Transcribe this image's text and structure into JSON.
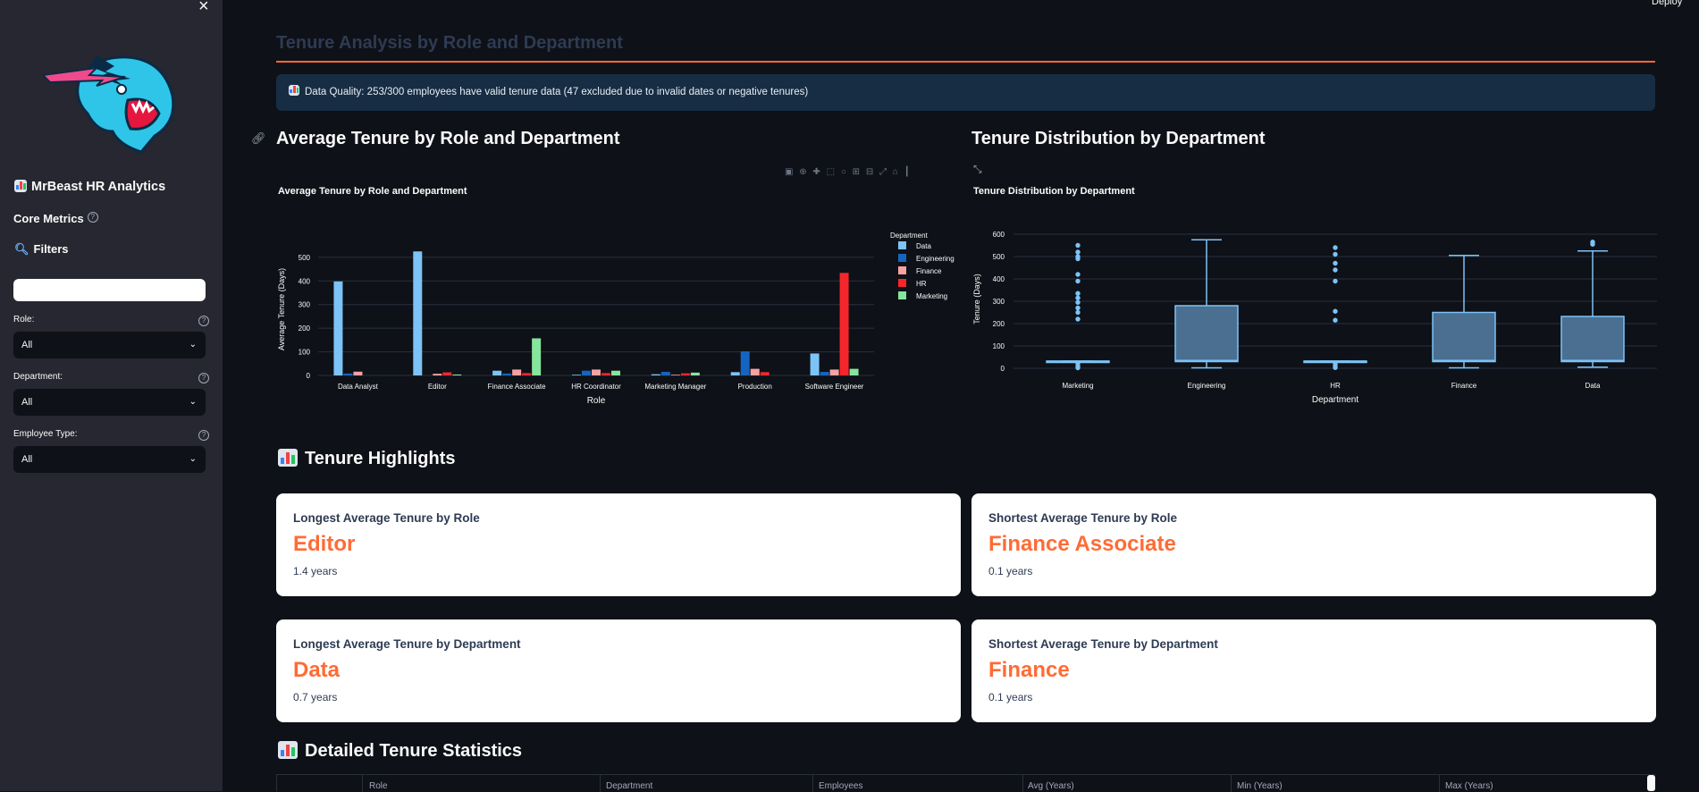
{
  "sidebar": {
    "close_icon": "×",
    "app_title": "MrBeast HR Analytics",
    "core_metrics": "Core Metrics",
    "filters": "Filters",
    "search_value": "",
    "role_label": "Role:",
    "role_value": "All",
    "department_label": "Department:",
    "department_value": "All",
    "employee_type_label": "Employee Type:",
    "employee_type_value": "All"
  },
  "topbar": {
    "deploy_label": "Deploy"
  },
  "page": {
    "header": "Tenure Analysis by Role and Department",
    "data_quality": "Data Quality: 253/300 employees have valid tenure data (47 excluded due to invalid dates or negative tenures)"
  },
  "sections": {
    "bar_section_title": "Average Tenure by Role and Department",
    "box_section_title": "Tenure Distribution by Department",
    "highlights_title": "Tenure Highlights",
    "details_title": "Detailed Tenure Statistics"
  },
  "highlights": [
    {
      "label": "Longest Average Tenure by Role",
      "value": "Editor",
      "sub": "1.4 years"
    },
    {
      "label": "Shortest Average Tenure by Role",
      "value": "Finance Associate",
      "sub": "0.1 years"
    },
    {
      "label": "Longest Average Tenure by Department",
      "value": "Data",
      "sub": "0.7 years"
    },
    {
      "label": "Shortest Average Tenure by Department",
      "value": "Finance",
      "sub": "0.1 years"
    }
  ],
  "table": {
    "columns": [
      "Role",
      "Department",
      "Employees",
      "Avg (Years)",
      "Min (Years)",
      "Max (Years)"
    ]
  },
  "colors": {
    "accent": "#ff6b35",
    "Data": "#7cc3f7",
    "Engineering": "#1565c0",
    "Finance": "#f7a1a1",
    "HR": "#f5262b",
    "Marketing": "#86e59c"
  },
  "chart_data": [
    {
      "type": "bar",
      "title": "Average Tenure by Role and Department",
      "xlabel": "Role",
      "ylabel": "Average Tenure (Days)",
      "ylim": [
        0,
        560
      ],
      "yticks": [
        0,
        100,
        200,
        300,
        400,
        500
      ],
      "legend_title": "Department",
      "legend_position": "top-right",
      "grid": true,
      "categories": [
        "Data Analyst",
        "Editor",
        "Finance Associate",
        "HR Coordinator",
        "Marketing Manager",
        "Production",
        "Software Engineer"
      ],
      "series": [
        {
          "name": "Data",
          "values": [
            398,
            525,
            20,
            3,
            5,
            14,
            93
          ]
        },
        {
          "name": "Engineering",
          "values": [
            8,
            0,
            8,
            20,
            15,
            102,
            15
          ]
        },
        {
          "name": "Finance",
          "values": [
            16,
            7,
            25,
            25,
            3,
            28,
            25
          ]
        },
        {
          "name": "HR",
          "values": [
            0,
            13,
            10,
            10,
            9,
            14,
            434
          ]
        },
        {
          "name": "Marketing",
          "values": [
            0,
            4,
            157,
            20,
            12,
            0,
            28
          ]
        }
      ]
    },
    {
      "type": "box",
      "title": "Tenure Distribution by Department",
      "xlabel": "Department",
      "ylabel": "Tenure (Days)",
      "ylim": [
        0,
        620
      ],
      "yticks": [
        0,
        100,
        200,
        300,
        400,
        500,
        600
      ],
      "grid": true,
      "categories": [
        "Marketing",
        "Engineering",
        "HR",
        "Finance",
        "Data"
      ],
      "boxes": [
        {
          "name": "Marketing",
          "min": 30,
          "q1": 30,
          "median": 32,
          "q3": 32,
          "max": 32,
          "outliers": [
            550,
            520,
            500,
            490,
            420,
            390,
            335,
            315,
            295,
            270,
            250,
            220,
            22,
            10,
            2
          ]
        },
        {
          "name": "Engineering",
          "min": 2,
          "q1": 30,
          "median": 35,
          "q3": 280,
          "max": 575
        },
        {
          "name": "HR",
          "min": 30,
          "q1": 30,
          "median": 32,
          "q3": 32,
          "max": 32,
          "outliers": [
            540,
            510,
            470,
            440,
            390,
            255,
            215,
            22,
            12,
            3
          ]
        },
        {
          "name": "Finance",
          "min": 2,
          "q1": 30,
          "median": 35,
          "q3": 250,
          "max": 505
        },
        {
          "name": "Data",
          "min": 5,
          "q1": 30,
          "median": 35,
          "q3": 232,
          "max": 525,
          "outliers": [
            565,
            555
          ]
        }
      ]
    }
  ]
}
